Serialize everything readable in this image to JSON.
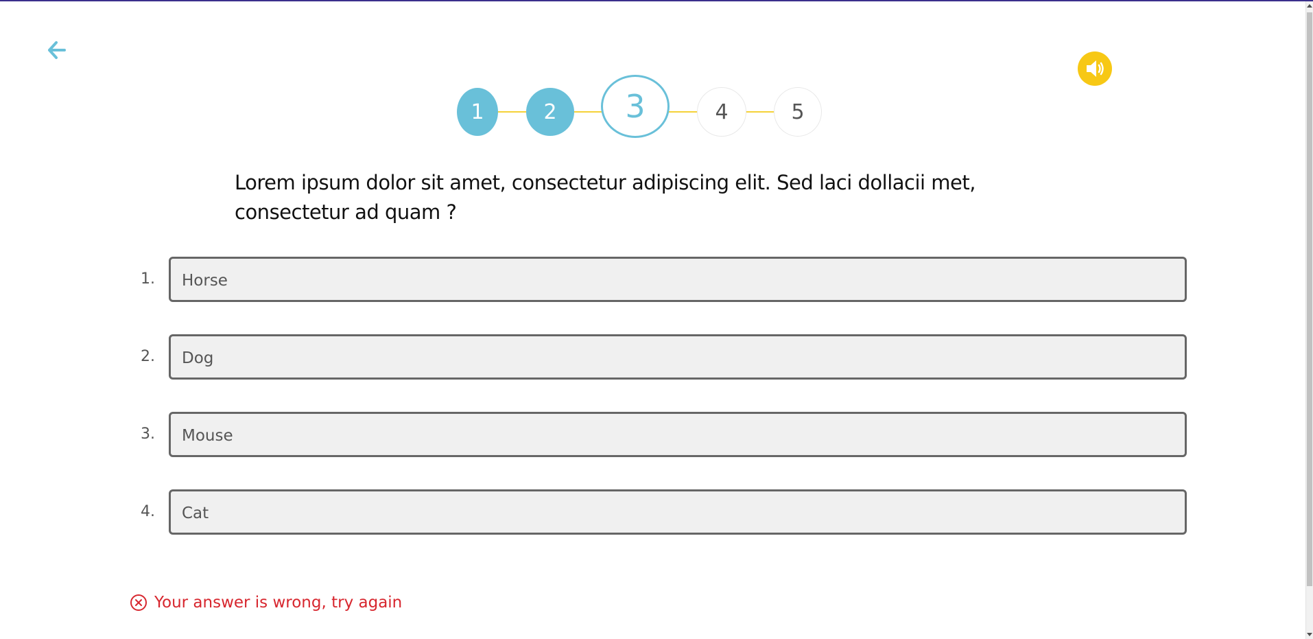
{
  "colors": {
    "accent": "#69c0d9",
    "connector": "#f5d238",
    "audio": "#f7c815",
    "error": "#d7262e",
    "top_bar": "#3a2f8c"
  },
  "nav": {
    "back_icon": "arrow-left-icon",
    "audio_icon": "speaker-icon"
  },
  "stepper": {
    "current": 3,
    "steps": [
      {
        "label": "1",
        "state": "done"
      },
      {
        "label": "2",
        "state": "done"
      },
      {
        "label": "3",
        "state": "current"
      },
      {
        "label": "4",
        "state": "todo"
      },
      {
        "label": "5",
        "state": "todo"
      }
    ]
  },
  "question": {
    "text": "Lorem ipsum dolor sit amet, consectetur adipiscing elit. Sed laci dollacii met, consectetur ad quam ?"
  },
  "answers": [
    {
      "number": "1.",
      "text": "Horse"
    },
    {
      "number": "2.",
      "text": "Dog"
    },
    {
      "number": "3.",
      "text": "Mouse"
    },
    {
      "number": "4.",
      "text": "Cat"
    }
  ],
  "feedback": {
    "icon": "close-circle-icon",
    "text": "Your answer is wrong, try again"
  }
}
